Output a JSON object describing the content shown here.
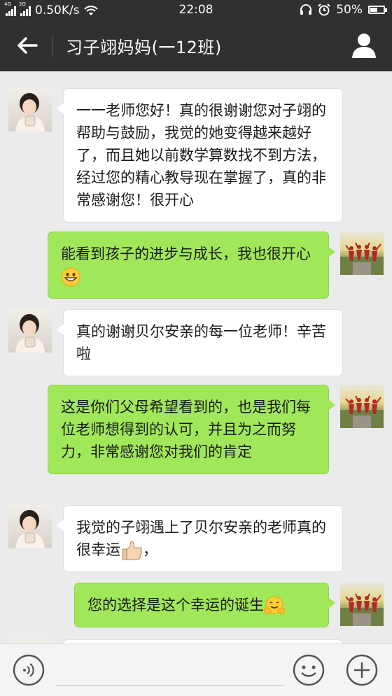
{
  "status_bar": {
    "network_1": "4G",
    "network_2": "2G",
    "speed": "0.50K/s",
    "time": "22:08",
    "battery": "50%"
  },
  "header": {
    "title": "习子翊妈妈(一12班)"
  },
  "messages": [
    {
      "sender": "parent",
      "text": "一一老师您好！真的很谢谢您对子翊的帮助与鼓励，我觉的她变得越来越好了，而且她以前数学算数找不到方法，经过您的精心教导现在掌握了，真的非常感谢您！很开心"
    },
    {
      "sender": "teacher",
      "text": "能看到孩子的进步与成长，我也很开心",
      "emoji": "grinning-face"
    },
    {
      "sender": "parent",
      "text": "真的谢谢贝尔安亲的每一位老师！辛苦啦"
    },
    {
      "sender": "teacher",
      "text": "这是你们父母希望看到的，也是我们每位老师想得到的认可，并且为之而努力，非常感谢您对我们的肯定"
    },
    {
      "sender": "parent",
      "text": "我觉的子翊遇上了贝尔安亲的老师真的很幸运",
      "text_after": "，",
      "emoji": "thumbs-up"
    },
    {
      "sender": "teacher",
      "text": "您的选择是这个幸运的诞生",
      "emoji": "hugging-face"
    }
  ],
  "colors": {
    "header_bg": "#2e3032",
    "chat_bg": "#ebebeb",
    "sent_bubble": "#a0e75a",
    "received_bubble": "#ffffff"
  },
  "icons": {
    "back": "back-arrow-icon",
    "profile": "person-icon",
    "voice": "voice-icon",
    "emoji": "emoji-icon",
    "plus": "plus-icon"
  }
}
